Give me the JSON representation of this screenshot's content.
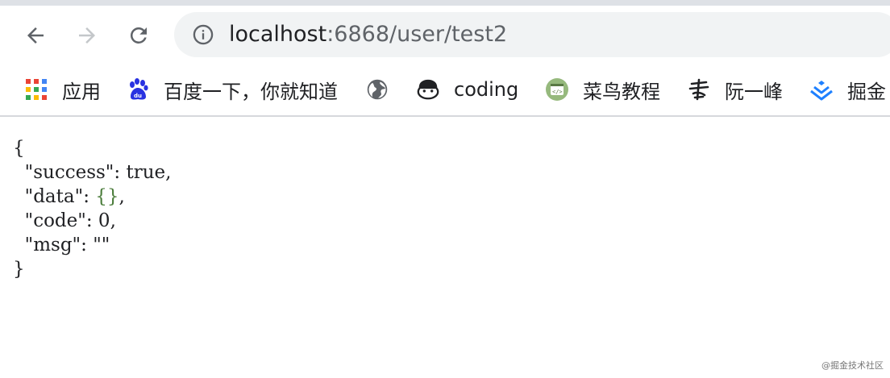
{
  "toolbar": {
    "back_icon": "arrow-left-icon",
    "forward_icon": "arrow-right-icon",
    "reload_icon": "reload-icon",
    "site_info_icon": "info-icon",
    "url_host": "localhost",
    "url_rest": ":6868/user/test2"
  },
  "bookmarks": {
    "items": [
      {
        "label": "应用",
        "icon": "apps-grid-icon"
      },
      {
        "label": "百度一下，你就知道",
        "icon": "baidu-paw-icon"
      },
      {
        "label": "",
        "icon": "globe-icon"
      },
      {
        "label": "coding",
        "icon": "coding-monkey-icon"
      },
      {
        "label": "菜鸟教程",
        "icon": "runoob-icon"
      },
      {
        "label": "阮一峰",
        "icon": "ruanyifeng-calligraphy-icon"
      },
      {
        "label": "掘金",
        "icon": "juejin-icon"
      }
    ]
  },
  "json_body": {
    "open_brace": "{",
    "lines": [
      {
        "key": "\"success\"",
        "sep": ": ",
        "value": "true",
        "tail": ","
      },
      {
        "key": "\"data\"",
        "sep": ": ",
        "value": "{}",
        "tail": ","
      },
      {
        "key": "\"code\"",
        "sep": ": ",
        "value": "0",
        "tail": ","
      },
      {
        "key": "\"msg\"",
        "sep": ": ",
        "value": "\"\"",
        "tail": ""
      }
    ],
    "close_brace": "}"
  },
  "watermark": "@掘金技术社区",
  "colors": {
    "chrome_bg": "#dee1e6",
    "omnibox_bg": "#f1f3f4",
    "icon_grey": "#5f6368",
    "json_green": "#4a7c3a"
  }
}
